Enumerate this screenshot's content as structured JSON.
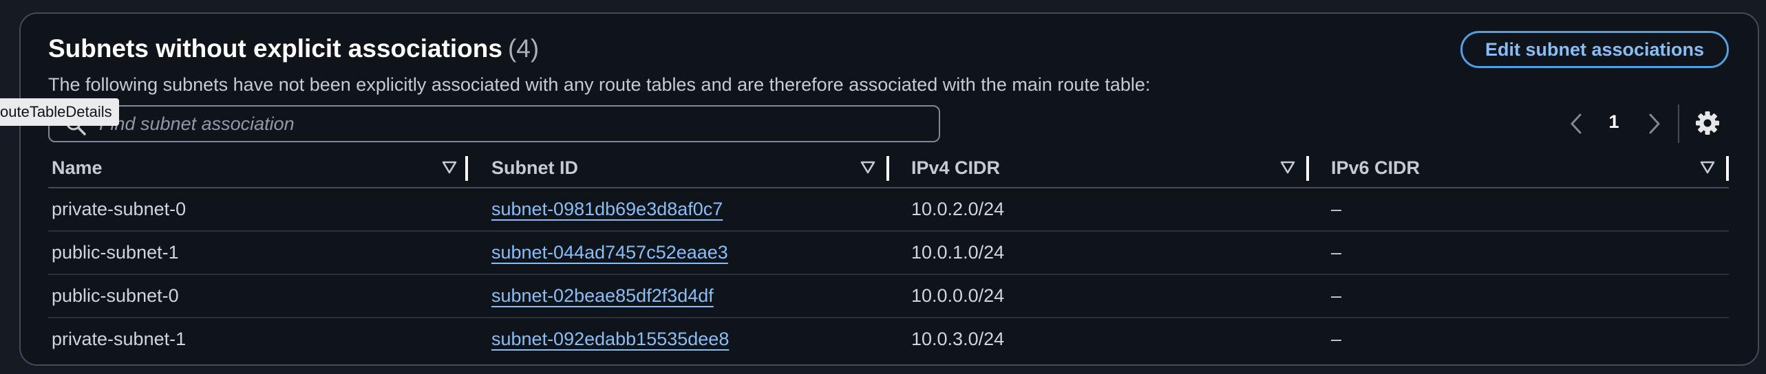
{
  "panel": {
    "title": "Subnets without explicit associations",
    "count": "(4)",
    "description": "The following subnets have not been explicitly associated with any route tables and are therefore associated with the main route table:",
    "edit_button_label": "Edit subnet associations"
  },
  "tooltip": {
    "text": "outeTableDetails"
  },
  "search": {
    "placeholder": "Find subnet association",
    "value": ""
  },
  "pagination": {
    "current_page": "1",
    "prev_icon": "chevron-left-icon",
    "next_icon": "chevron-right-icon",
    "settings_icon": "gear-icon"
  },
  "table": {
    "columns": [
      {
        "label": "Name"
      },
      {
        "label": "Subnet ID"
      },
      {
        "label": "IPv4 CIDR"
      },
      {
        "label": "IPv6 CIDR"
      }
    ],
    "rows": [
      {
        "name": "private-subnet-0",
        "subnet_id": "subnet-0981db69e3d8af0c7",
        "ipv4": "10.0.2.0/24",
        "ipv6": "–"
      },
      {
        "name": "public-subnet-1",
        "subnet_id": "subnet-044ad7457c52eaae3",
        "ipv4": "10.0.1.0/24",
        "ipv6": "–"
      },
      {
        "name": "public-subnet-0",
        "subnet_id": "subnet-02beae85df2f3d4df",
        "ipv4": "10.0.0.0/24",
        "ipv6": "–"
      },
      {
        "name": "private-subnet-1",
        "subnet_id": "subnet-092edabb15535dee8",
        "ipv4": "10.0.3.0/24",
        "ipv6": "–"
      }
    ]
  },
  "colors": {
    "background": "#0f141b",
    "link": "#89bdf6",
    "button_border": "#539fe5",
    "border": "#414b5a"
  }
}
